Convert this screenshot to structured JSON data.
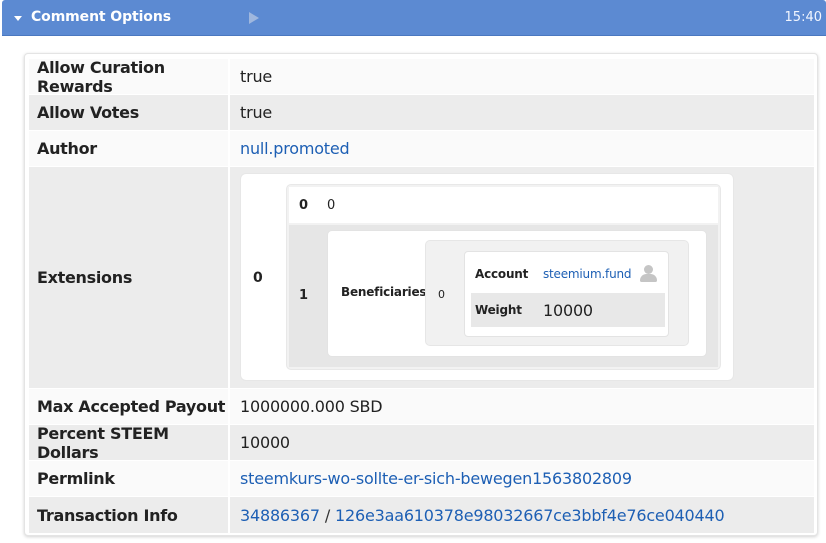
{
  "header": {
    "title": "Comment Options",
    "time": "15:40"
  },
  "rows": {
    "allow_curation_rewards": {
      "label": "Allow Curation Rewards",
      "value": "true"
    },
    "allow_votes": {
      "label": "Allow Votes",
      "value": "true"
    },
    "author": {
      "label": "Author",
      "value": "null.promoted"
    },
    "extensions": {
      "label": "Extensions",
      "index0": "0",
      "inner": {
        "row0_key": "0",
        "row0_value": "0",
        "row1_key": "1",
        "beneficiaries_label": "Beneficiaries",
        "beneficiary_index": "0",
        "account_label": "Account",
        "account_value": "steemium.fund",
        "weight_label": "Weight",
        "weight_value": "10000"
      }
    },
    "max_accepted_payout": {
      "label": "Max Accepted Payout",
      "value": "1000000.000 SBD"
    },
    "percent_steem_dollars": {
      "label": "Percent STEEM Dollars",
      "value": "10000"
    },
    "permlink": {
      "label": "Permlink",
      "value": "steemkurs-wo-sollte-er-sich-bewegen1563802809"
    },
    "transaction_info": {
      "label": "Transaction Info",
      "block": "34886367",
      "separator": "/",
      "tx_id": "126e3aa610378e98032667ce3bbf4e76ce040440"
    }
  },
  "icons": {
    "header_caret": "caret-down-icon",
    "header_play": "play-icon",
    "account_user": "user-icon"
  },
  "colors": {
    "header_bg": "#5c8ad2",
    "link": "#1d5fb4"
  }
}
